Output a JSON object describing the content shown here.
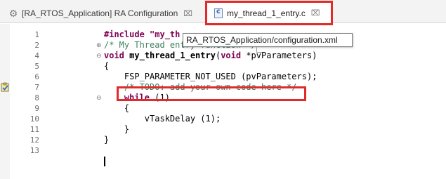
{
  "tabs": [
    {
      "label": "[RA_RTOS_Application] RA Configuration",
      "close": "⌧"
    },
    {
      "label": "my_thread_1_entry.c",
      "close": "⌧"
    }
  ],
  "tooltip": {
    "text": "RA_RTOS_Application/configuration.xml"
  },
  "editor": {
    "line_numbers": [
      "1",
      "2",
      "4",
      "5",
      "6",
      "7",
      "8",
      "9",
      "10",
      "11",
      "12",
      "13"
    ],
    "lines": [
      {
        "t1": "#include \"my_th"
      },
      {
        "t1": "/* My Thread entry function */"
      },
      {
        "t1": "void",
        "t2": "my_thread_1_entry",
        "t3": "(",
        "t4": "void",
        "t5": " *pvParameters)"
      },
      {
        "t1": "{"
      },
      {
        "t1": "    FSP_PARAMETER_NOT_USED (pvParameters);"
      },
      {
        "t1": "    /* TODO: add your own code here */"
      },
      {
        "t1": "    while",
        "t2": " (1)"
      },
      {
        "t1": "    {"
      },
      {
        "t1": "        vTaskDelay (1);"
      },
      {
        "t1": "    }"
      },
      {
        "t1": "}"
      },
      {
        "t1": ""
      }
    ],
    "fold_markers": {
      "expand": "⊕",
      "collapse": "⊖"
    }
  }
}
